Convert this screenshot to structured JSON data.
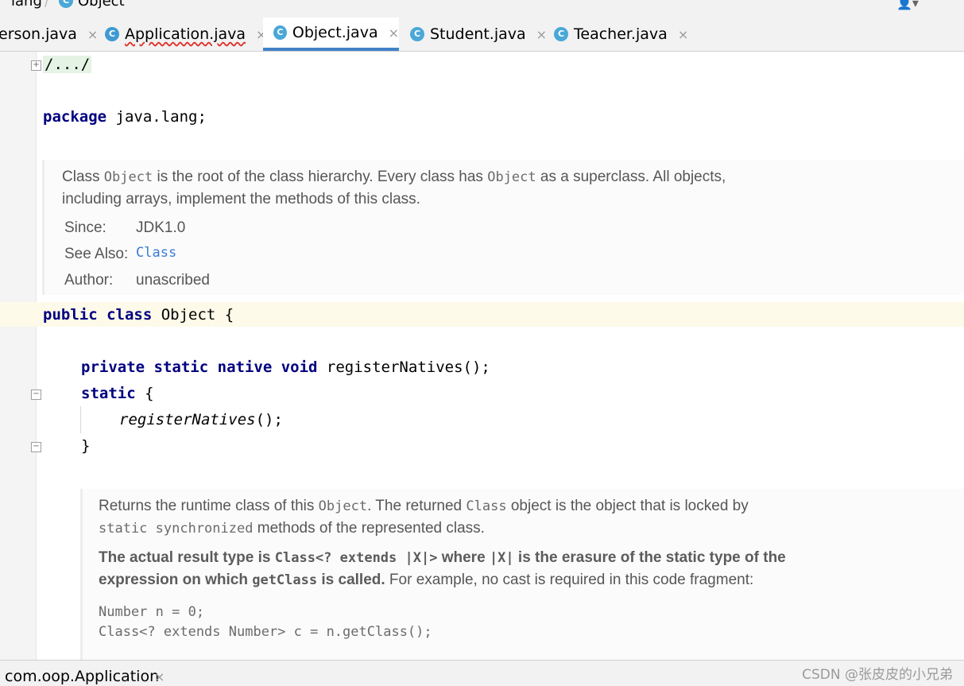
{
  "breadcrumb": {
    "items": [
      "lang",
      "Object"
    ]
  },
  "tabs": [
    {
      "label": "erson.java",
      "active": false
    },
    {
      "label": "Application.java",
      "active": false
    },
    {
      "label": "Object.java",
      "active": true
    },
    {
      "label": "Student.java",
      "active": false
    },
    {
      "label": "Teacher.java",
      "active": false
    }
  ],
  "close_glyph": "×",
  "editor": {
    "folded_header": "/.../",
    "package_keyword": "package",
    "package_name": " java.lang;",
    "doc1": {
      "t1": "Class ",
      "c1": "Object",
      "t2": " is the root of the class hierarchy. Every class has ",
      "c2": "Object",
      "t3": " as a superclass. All objects,",
      "line2": "including arrays, implement the methods of this class.",
      "since_label": "Since:",
      "since_value": "JDK1.0",
      "see_label": "See Also:",
      "see_value": "Class",
      "author_label": "Author:",
      "author_value": "unascribed"
    },
    "class_decl": {
      "kw1": "public",
      "kw2": "class",
      "rest": " Object {"
    },
    "native_decl": {
      "kw1": "private",
      "kw2": "static",
      "kw3": "native",
      "kw4": "void",
      "rest": " registerNatives();"
    },
    "static_block": {
      "kw": "static",
      "rest": " {"
    },
    "call_line": {
      "name": "registerNatives",
      "rest": "();"
    },
    "closing_brace": "}",
    "doc2": {
      "a1": "Returns the runtime class of this ",
      "a2": "Object",
      "a3": ". The returned ",
      "a4": "Class",
      "a5": " object is the object that is locked by",
      "b1": "static synchronized",
      "b2": " methods of the represented class.",
      "c1": "The actual result type is ",
      "c2": "Class<? extends |X|>",
      "c3": " where ",
      "c4": "|X|",
      "c5": " is the erasure of the static type of the",
      "d1": "expression on which ",
      "d2": "getClass",
      "d3": " is called.",
      "d4": " For example, no cast is required in this code fragment:",
      "e1": "Number n = 0;",
      "e2": "Class<? extends Number> c = n.getClass();"
    }
  },
  "bottom_bar": {
    "run_config": "com.oop.Application"
  },
  "watermark": "CSDN @张皮皮的小兄弟",
  "colors": {
    "keyword": "#000080",
    "link": "#3a7bd5",
    "tab_underline": "#4083c9",
    "class_icon": "#4aa8d8"
  }
}
